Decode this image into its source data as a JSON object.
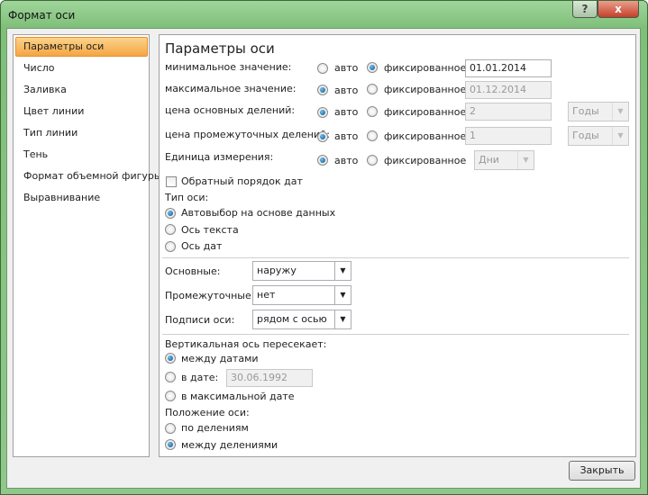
{
  "window": {
    "title": "Формат оси",
    "help": "?",
    "close": "x"
  },
  "sidebar": {
    "items": [
      "Параметры оси",
      "Число",
      "Заливка",
      "Цвет линии",
      "Тип линии",
      "Тень",
      "Формат объемной фигуры",
      "Выравнивание"
    ]
  },
  "main": {
    "heading": "Параметры оси",
    "auto": "авто",
    "fixed": "фиксированное",
    "rows": [
      {
        "label": "минимальное значение:",
        "mode": "fixed",
        "value": "01.01.2014"
      },
      {
        "label": "максимальное значение:",
        "mode": "auto",
        "value": "01.12.2014"
      },
      {
        "label": "цена основных делений:",
        "mode": "auto",
        "value": "2",
        "unit": "Годы"
      },
      {
        "label": "цена промежуточных делений:",
        "mode": "auto",
        "value": "1",
        "unit": "Годы"
      },
      {
        "label": "Единица измерения:",
        "mode": "auto",
        "unit": "Дни"
      }
    ],
    "reverse_label": "Обратный порядок дат",
    "axis_type": {
      "label": "Тип оси:",
      "options": [
        "Автовыбор на основе данных",
        "Ось текста",
        "Ось дат"
      ],
      "selected": 0
    },
    "ticks": [
      {
        "label": "Основные:",
        "value": "наружу"
      },
      {
        "label": "Промежуточные:",
        "value": "нет"
      },
      {
        "label": "Подписи оси:",
        "value": "рядом с осью"
      }
    ],
    "cross": {
      "label": "Вертикальная ось пересекает:",
      "options": [
        "между датами",
        "в дате:",
        "в максимальной дате"
      ],
      "selected": 0,
      "date": "30.06.1992"
    },
    "position": {
      "label": "Положение оси:",
      "options": [
        "по делениям",
        "между делениями"
      ],
      "selected": 1
    }
  },
  "footer": {
    "close": "Закрыть"
  }
}
